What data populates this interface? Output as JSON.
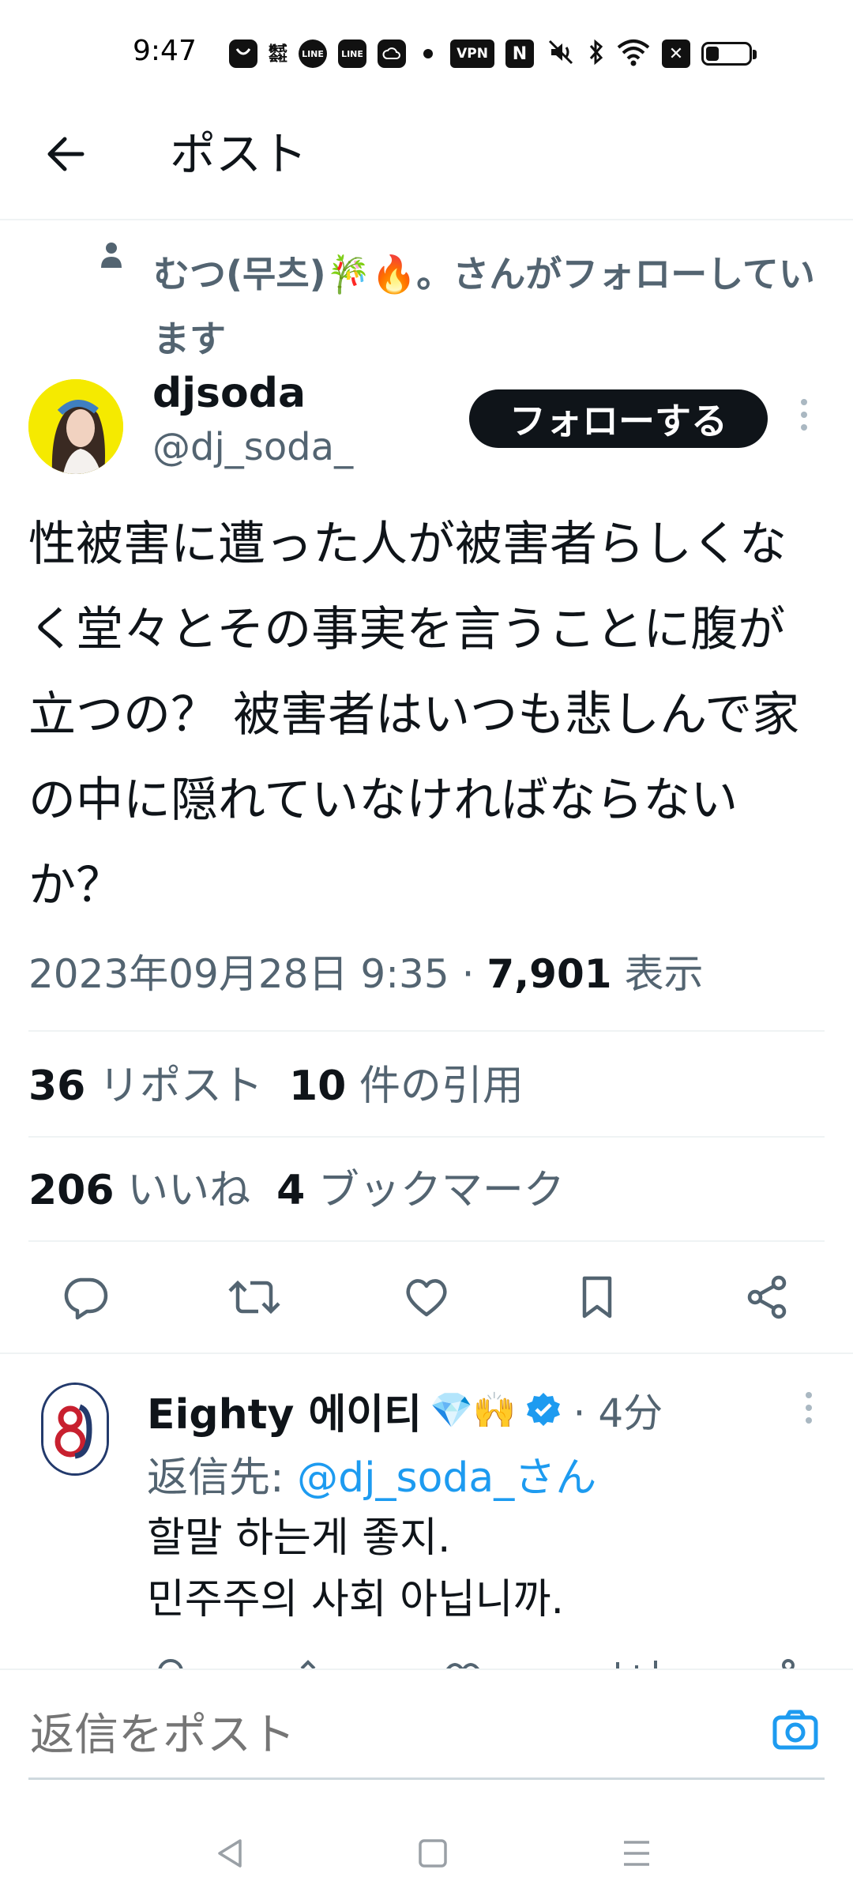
{
  "status_bar": {
    "time": "9:47",
    "icons": [
      "notification-icon",
      "app-icon",
      "line-icon",
      "line-manga-icon",
      "cloud-icon",
      "vpn-icon",
      "nfc-icon",
      "mute-icon",
      "bluetooth-icon",
      "wifi-icon",
      "x-icon",
      "battery-icon"
    ],
    "labels": {
      "line": "LINE",
      "line_manga": "LINE",
      "vpn": "VPN",
      "nfc": "N"
    },
    "battery_level": 0.3
  },
  "header": {
    "title": "ポスト"
  },
  "social_context": {
    "text": "むつ(무츠)🎋🔥。さんがフォローしています"
  },
  "post": {
    "author_name": "djsoda",
    "author_handle": "@dj_soda_",
    "follow_label": "フォローする",
    "text": "性被害に遭った人が被害者らしくなく堂々とその事実を言うことに腹が立つの？ 被害者はいつも悲しんで家の中に隠れていなければならないか？",
    "date": "2023年09月28日 9:35",
    "separator": "·",
    "views_count": "7,901",
    "views_label": "表示"
  },
  "stats": {
    "reposts_count": "36",
    "reposts_label": "リポスト",
    "quotes_count": "10",
    "quotes_label": "件の引用",
    "likes_count": "206",
    "likes_label": "いいね",
    "bookmarks_count": "4",
    "bookmarks_label": "ブックマーク"
  },
  "actions": [
    "reply-icon",
    "repost-icon",
    "like-icon",
    "bookmark-icon",
    "share-icon"
  ],
  "reply": {
    "name": "Eighty 에이티",
    "emoji": "💎🙌",
    "time": "· 4分",
    "reply_to_prefix": "返信先: ",
    "reply_to_handle": "@dj_soda_さん",
    "body": "할말 하는게 좋지.\n민주주의 사회 아닙니까."
  },
  "composer": {
    "placeholder": "返信をポスト"
  },
  "colors": {
    "accent": "#1d9bf0",
    "text": "#0f1419",
    "secondary": "#536471",
    "follow_bg": "#0f1419"
  }
}
